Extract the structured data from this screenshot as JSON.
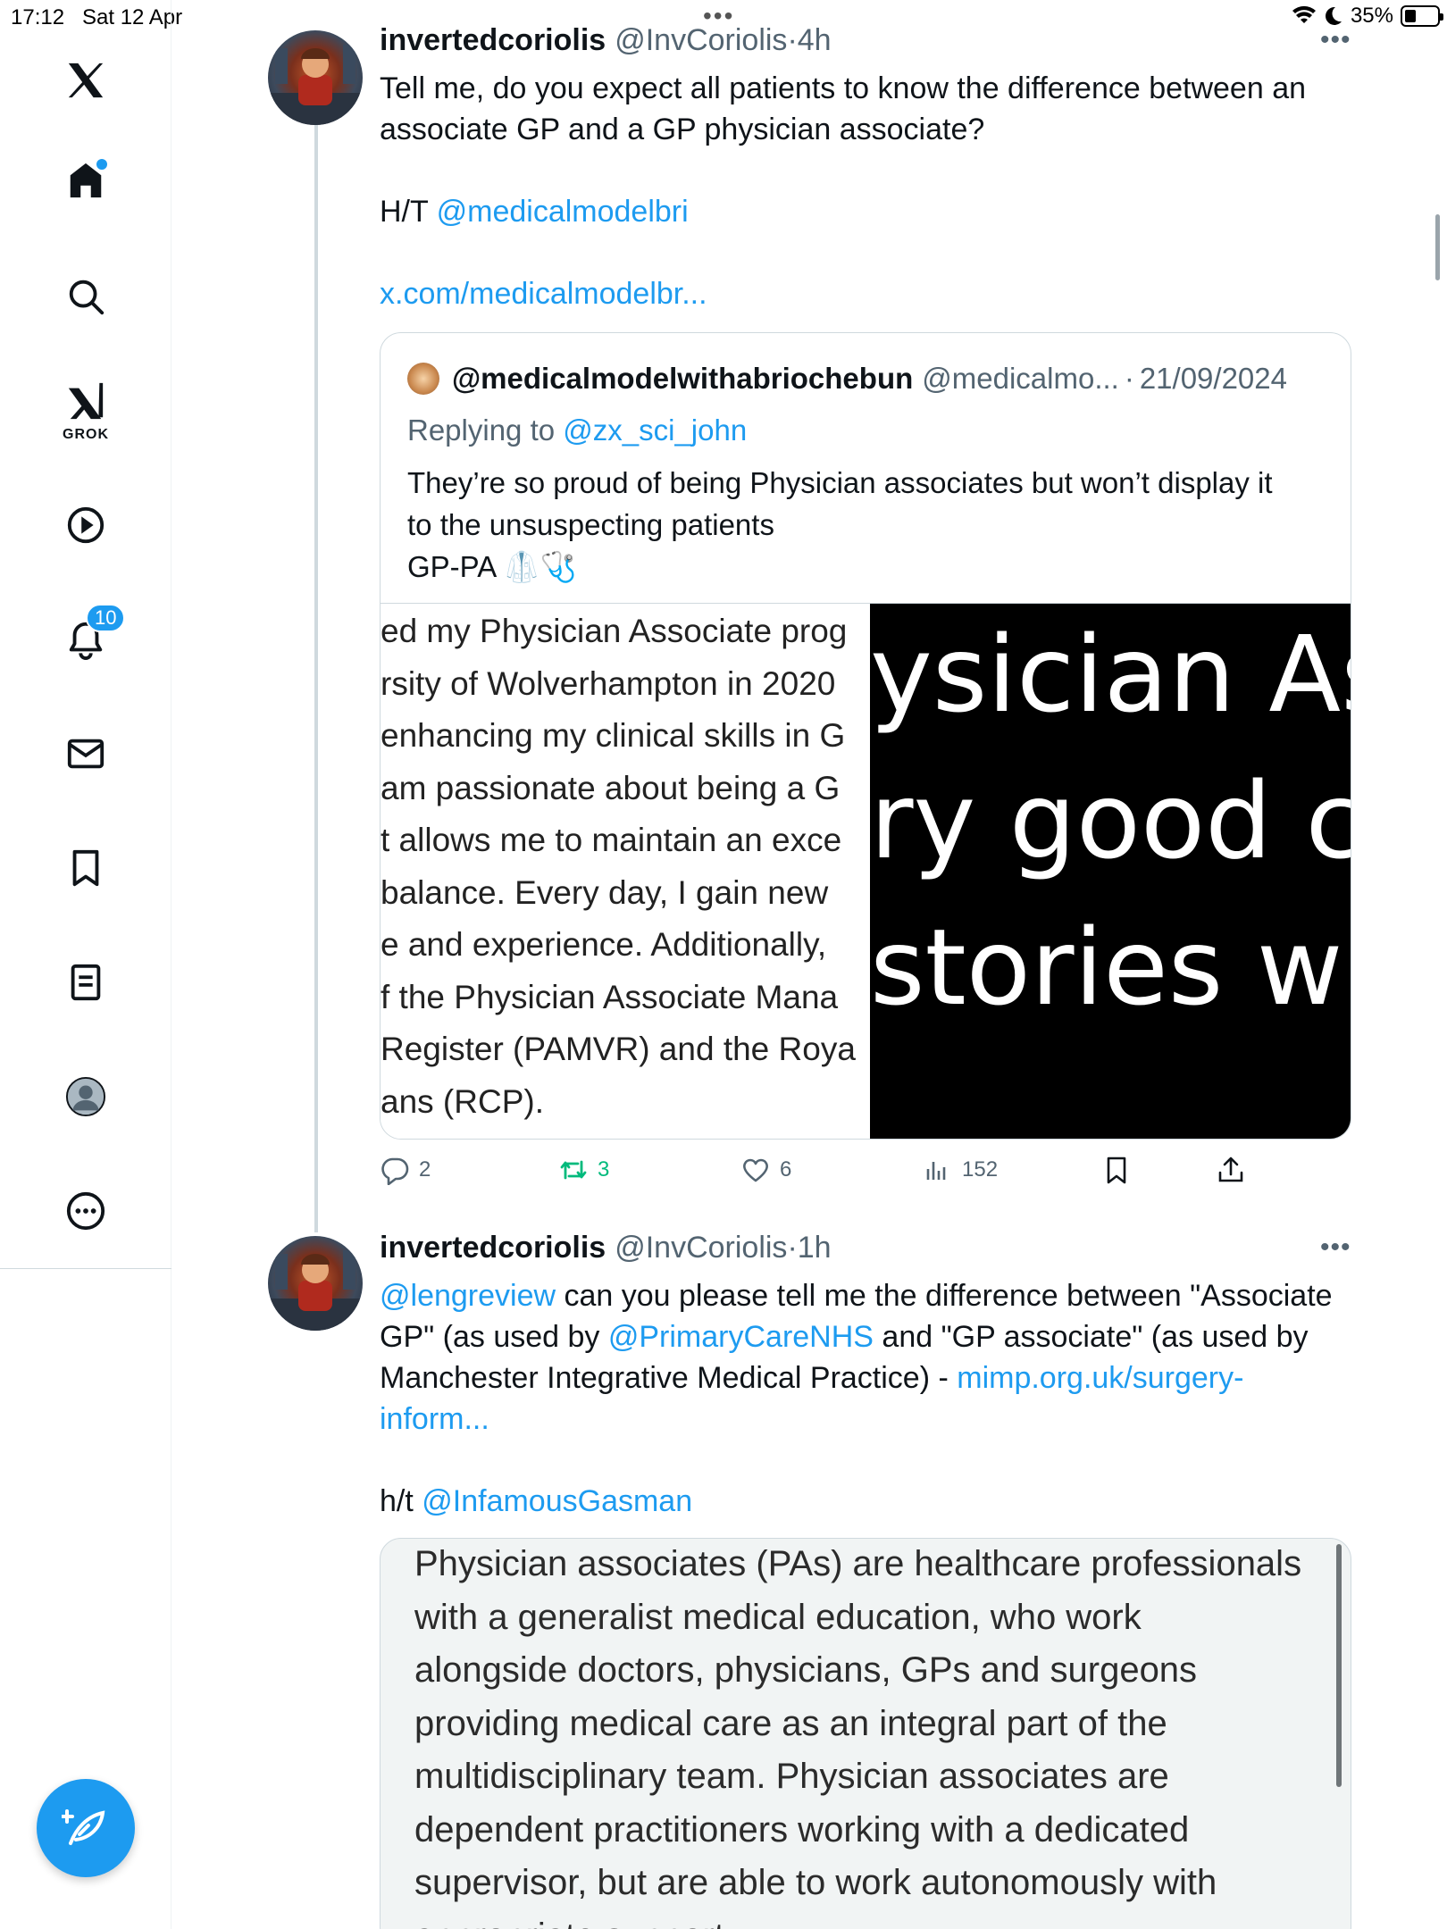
{
  "status_bar": {
    "time": "17:12",
    "date": "Sat 12 Apr",
    "battery_percent": "35%",
    "battery_level": 0.35
  },
  "sidebar": {
    "items": [
      {
        "name": "x-logo",
        "icon": "x-logo-icon"
      },
      {
        "name": "home",
        "icon": "home-icon",
        "has_dot": true
      },
      {
        "name": "search",
        "icon": "search-icon"
      },
      {
        "name": "grok",
        "icon": "grok-icon",
        "label": "GROK"
      },
      {
        "name": "videos",
        "icon": "play-icon"
      },
      {
        "name": "notifications",
        "icon": "bell-icon",
        "badge": "10"
      },
      {
        "name": "messages",
        "icon": "mail-icon"
      },
      {
        "name": "bookmarks",
        "icon": "bookmark-icon"
      },
      {
        "name": "lists",
        "icon": "list-icon"
      },
      {
        "name": "profile",
        "icon": "profile-icon"
      },
      {
        "name": "more",
        "icon": "more-icon"
      }
    ],
    "accent_color": "#1d9bf0"
  },
  "tweets": [
    {
      "display_name": "invertedcoriolis",
      "handle": "@InvCoriolis",
      "sep": "·",
      "time": "4h",
      "text_line1": "Tell me, do you expect all patients to know the difference between an",
      "text_line2": "associate GP and a GP physician associate?",
      "ht_prefix": "H/T ",
      "ht_mention": "@medicalmodelbri",
      "link": "x.com/medicalmodelbr...",
      "quote": {
        "display_name": "@medicalmodelwithabriochebun",
        "handle": "@medicalmo...",
        "sep": "·",
        "date": "21/09/2024",
        "replying_prefix": "Replying to ",
        "replying_to": "@zx_sci_john",
        "text_line1": "They’re so proud of being Physician associates but won’t display it",
        "text_line2": "to the unsuspecting patients",
        "text_line3": "GP-PA 🥼🩺",
        "media_left_lines": [
          "ed my Physician Associate prog",
          "rsity of Wolverhampton in 2020",
          "enhancing my clinical skills in G",
          " am passionate about being a G",
          "t allows me to maintain an exce",
          "balance. Every day, I gain new",
          "e and experience. Additionally,",
          "f the Physician Associate Mana",
          " Register (PAMVR) and the Roya",
          "ans (RCP)."
        ],
        "media_right_lines": [
          "ysician As",
          "ry good c",
          "stories w"
        ]
      },
      "actions": {
        "replies": "2",
        "retweets": "3",
        "likes": "6",
        "views": "152"
      }
    },
    {
      "display_name": "invertedcoriolis",
      "handle": "@InvCoriolis",
      "sep": "·",
      "time": "1h",
      "mention1": "@lengreview",
      "text_part1": " can you please tell me the difference between \"Associate",
      "text_part2": "GP\" (as used by ",
      "mention2": "@PrimaryCareNHS",
      "text_part3": " and \"GP associate\" (as used by",
      "text_part4": "Manchester Integrative Medical Practice) - ",
      "link_part1": "mimp.org.uk/surgery-",
      "link_part2": "inform...",
      "ht_prefix": "h/t ",
      "ht_mention": "@InfamousGasman",
      "image_lines": [
        "Physician associates (PAs) are healthcare professionals",
        "with a generalist medical education, who work",
        "alongside doctors, physicians, GPs and surgeons",
        "providing medical care as an integral part of the",
        "multidisciplinary team. Physician associates are",
        "dependent practitioners working with a dedicated",
        "supervisor, but are able to work autonomously with",
        "appropriate support."
      ]
    }
  ]
}
